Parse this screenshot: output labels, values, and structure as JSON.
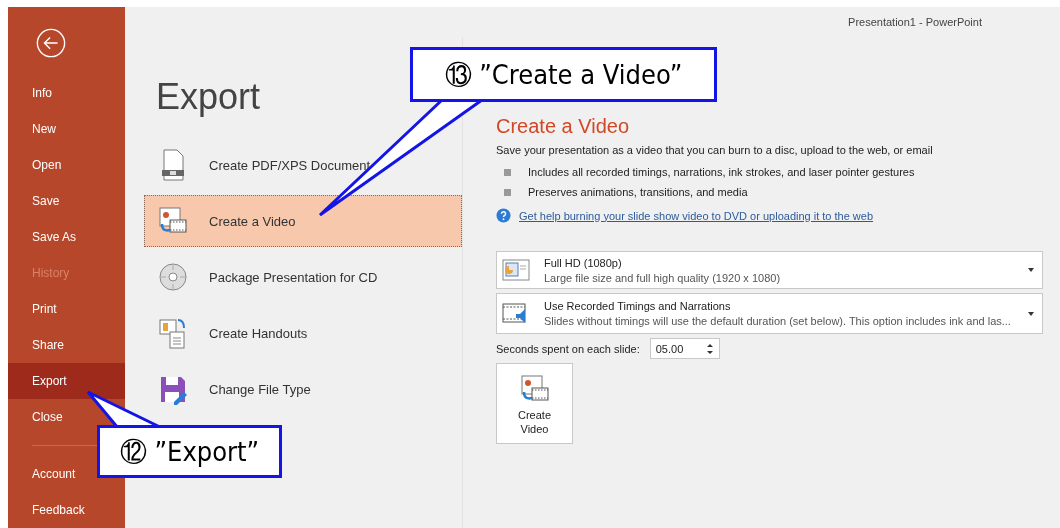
{
  "window": {
    "title": "Presentation1  -  PowerPoint"
  },
  "sidebar": {
    "items": [
      {
        "label": "Info",
        "selected": false,
        "disabled": false
      },
      {
        "label": "New",
        "selected": false,
        "disabled": false
      },
      {
        "label": "Open",
        "selected": false,
        "disabled": false
      },
      {
        "label": "Save",
        "selected": false,
        "disabled": false
      },
      {
        "label": "Save As",
        "selected": false,
        "disabled": false
      },
      {
        "label": "History",
        "selected": false,
        "disabled": true
      },
      {
        "label": "Print",
        "selected": false,
        "disabled": false
      },
      {
        "label": "Share",
        "selected": false,
        "disabled": false
      },
      {
        "label": "Export",
        "selected": true,
        "disabled": false
      },
      {
        "label": "Close",
        "selected": false,
        "disabled": false
      }
    ],
    "bottom_items": [
      {
        "label": "Account",
        "selected": false,
        "disabled": false
      },
      {
        "label": "Feedback",
        "selected": false,
        "disabled": false
      }
    ]
  },
  "page_title": "Export",
  "export_options": [
    {
      "label": "Create PDF/XPS Document",
      "kind": "pdf",
      "selected": false
    },
    {
      "label": "Create a Video",
      "kind": "video",
      "selected": true
    },
    {
      "label": "Package Presentation for CD",
      "kind": "cd",
      "selected": false
    },
    {
      "label": "Create Handouts",
      "kind": "handouts",
      "selected": false
    },
    {
      "label": "Change File Type",
      "kind": "filetype",
      "selected": false
    }
  ],
  "detail": {
    "heading": "Create a Video",
    "description": "Save your presentation as a video that you can burn to a disc, upload to the web, or email",
    "bullets": [
      "Includes all recorded timings, narrations, ink strokes, and laser pointer gestures",
      "Preserves animations, transitions, and media"
    ],
    "help_link": "Get help burning your slide show video to DVD or uploading it to the web",
    "dropdowns": [
      {
        "kind": "quality",
        "title": "Full HD (1080p)",
        "subtitle": "Large file size and full high quality (1920 x 1080)"
      },
      {
        "kind": "timings",
        "title": "Use Recorded Timings and Narrations",
        "subtitle": "Slides without timings will use the default duration (set below). This option includes ink and las..."
      }
    ],
    "seconds_label": "Seconds spent on each slide:",
    "seconds_value": "05.00",
    "create_button": "Create Video"
  },
  "annotations": [
    {
      "text": "⑬ ”Create a Video”"
    },
    {
      "text": "⑫ ”Export”"
    }
  ]
}
